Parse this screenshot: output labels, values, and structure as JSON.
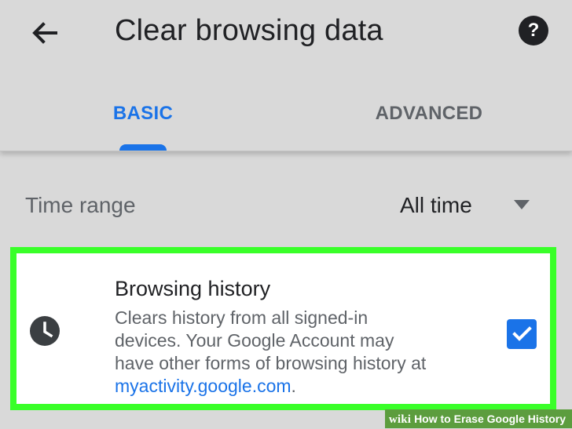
{
  "appbar": {
    "title": "Clear browsing data",
    "back_icon": "arrow-left-icon",
    "help_icon": "help-circle-icon",
    "help_symbol": "?"
  },
  "tabs": [
    {
      "label": "BASIC",
      "selected": true
    },
    {
      "label": "ADVANCED",
      "selected": false
    }
  ],
  "time_range": {
    "label": "Time range",
    "selected_value": "All time",
    "icon": "triangle-down-icon"
  },
  "browsing_history": {
    "icon": "clock-icon",
    "title": "Browsing history",
    "description_lines": [
      "Clears history from all signed-in",
      "devices. Your Google Account may",
      "have other forms of browsing history at"
    ],
    "link_text": "myactivity.google.com",
    "description_suffix": ".",
    "checked": true,
    "checkbox_icon": "checkmark-icon"
  },
  "watermark": {
    "brand": "wiki",
    "text": "How to Erase Google History"
  },
  "colors": {
    "background": "#d9d9d9",
    "accent": "#1a73e8",
    "highlight": "#39ff29",
    "watermark": "#5c9d3e"
  }
}
